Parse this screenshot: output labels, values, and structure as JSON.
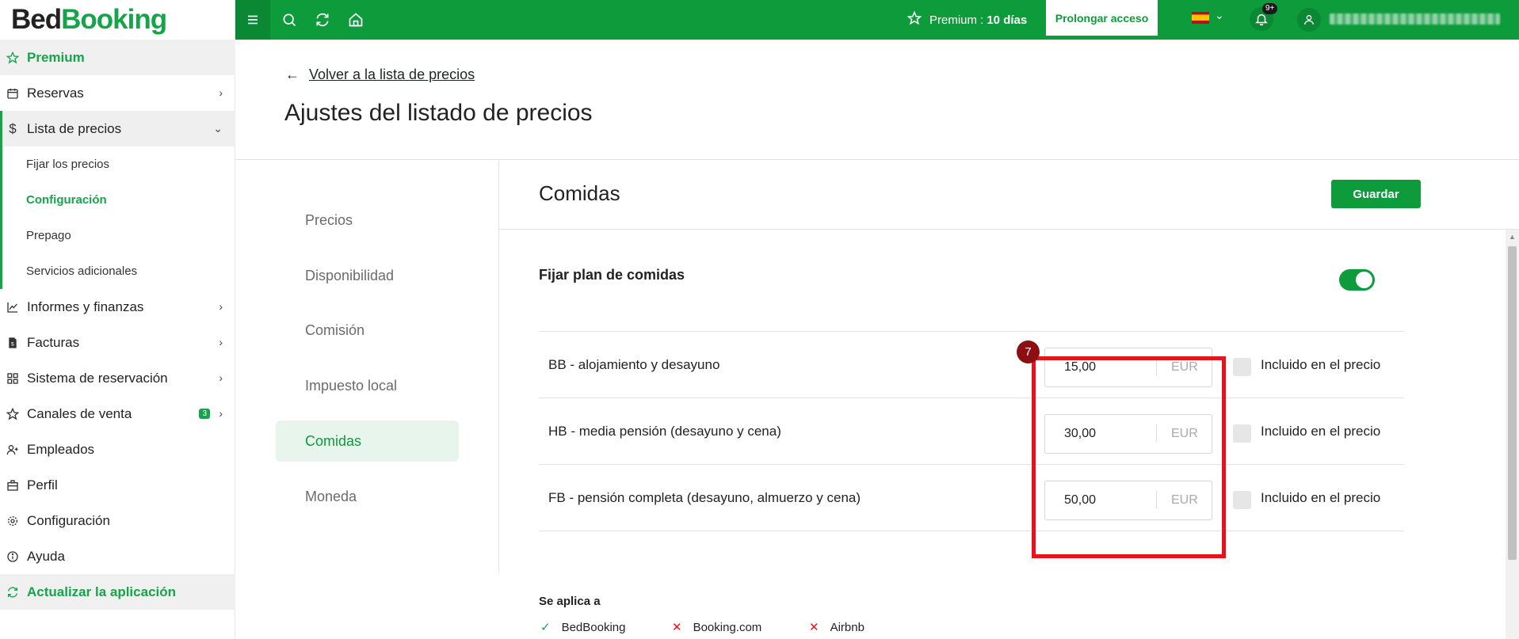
{
  "app": {
    "logo_bed": "Bed",
    "logo_booking": "Booking"
  },
  "sidebar": {
    "premium": "Premium",
    "items": [
      {
        "label": "Reservas"
      },
      {
        "label": "Lista de precios"
      },
      {
        "label": "Informes y finanzas"
      },
      {
        "label": "Facturas"
      },
      {
        "label": "Sistema de reservación"
      },
      {
        "label": "Canales de venta",
        "badge": "3"
      },
      {
        "label": "Empleados"
      },
      {
        "label": "Perfil"
      },
      {
        "label": "Configuración"
      },
      {
        "label": "Ayuda"
      }
    ],
    "subitems": [
      {
        "label": "Fijar los precios"
      },
      {
        "label": "Configuración"
      },
      {
        "label": "Prepago"
      },
      {
        "label": "Servicios adicionales"
      }
    ],
    "update": "Actualizar la aplicación"
  },
  "topbar": {
    "premium_label": "Premium :",
    "premium_days": "10 días",
    "prolongar": "Prolongar acceso",
    "notif_badge": "9+"
  },
  "page": {
    "back_link": "Volver a la lista de precios",
    "title": "Ajustes del listado de precios"
  },
  "subnav": [
    {
      "label": "Precios"
    },
    {
      "label": "Disponibilidad"
    },
    {
      "label": "Comisión"
    },
    {
      "label": "Impuesto local"
    },
    {
      "label": "Comidas"
    },
    {
      "label": "Moneda"
    }
  ],
  "section": {
    "title": "Comidas",
    "save": "Guardar",
    "toggle_label": "Fijar plan de comidas",
    "toggle_on": true,
    "meals": [
      {
        "label": "BB - alojamiento y desayuno",
        "price": "15,00",
        "currency": "EUR",
        "included_label": "Incluido en el precio"
      },
      {
        "label": "HB - media pensión (desayuno y cena)",
        "price": "30,00",
        "currency": "EUR",
        "included_label": "Incluido en el precio"
      },
      {
        "label": "FB - pensión completa (desayuno, almuerzo y cena)",
        "price": "50,00",
        "currency": "EUR",
        "included_label": "Incluido en el precio"
      }
    ],
    "marker": "7",
    "applies_title": "Se aplica a",
    "channels": [
      {
        "name": "BedBooking",
        "enabled": true
      },
      {
        "name": "Booking.com",
        "enabled": false
      },
      {
        "name": "Airbnb",
        "enabled": false
      }
    ]
  },
  "colors": {
    "brand_green": "#0d9b3c",
    "highlight_red": "#e3141c",
    "marker_red": "#8e0f12"
  }
}
